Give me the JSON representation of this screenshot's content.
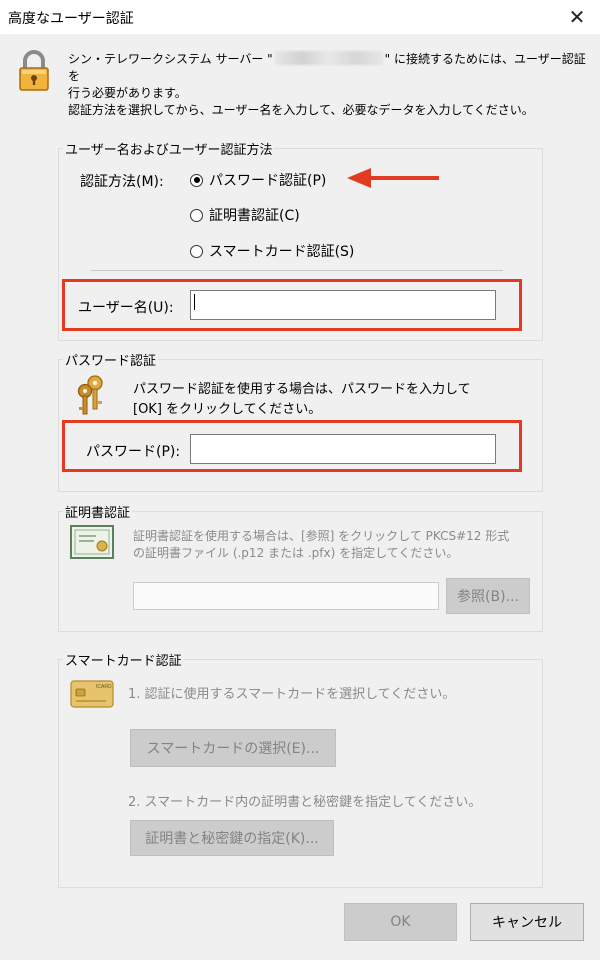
{
  "window": {
    "title": "高度なユーザー認証"
  },
  "intro": {
    "line1_before": "シン・テレワークシステム サーバー \"",
    "line1_after": "\" に接続するためには、ユーザー認証を",
    "line2": "行う必要があります。",
    "line3": "認証方法を選択してから、ユーザー名を入力して、必要なデータを入力してください。"
  },
  "user_group": {
    "title": "ユーザー名およびユーザー認証方法",
    "method_label": "認証方法(M):",
    "options": [
      {
        "label": "パスワード認証(P)",
        "selected": true
      },
      {
        "label": "証明書認証(C)",
        "selected": false
      },
      {
        "label": "スマートカード認証(S)",
        "selected": false
      }
    ],
    "username_label": "ユーザー名(U):",
    "username_value": ""
  },
  "password_group": {
    "title": "パスワード認証",
    "desc_line1": "パスワード認証を使用する場合は、パスワードを入力して",
    "desc_line2": "[OK] をクリックしてください。",
    "password_label": "パスワード(P):",
    "password_value": ""
  },
  "cert_group": {
    "title": "証明書認証",
    "desc_line1": "証明書認証を使用する場合は、[参照] をクリックして PKCS#12 形式",
    "desc_line2": "の証明書ファイル (.p12 または .pfx) を指定してください。",
    "browse_label": "参照(B)..."
  },
  "smartcard_group": {
    "title": "スマートカード認証",
    "step1": "1. 認証に使用するスマートカードを選択してください。",
    "select_button": "スマートカードの選択(E)...",
    "step2": "2. スマートカード内の証明書と秘密鍵を指定してください。",
    "key_button": "証明書と秘密鍵の指定(K)...",
    "card_text": "ICARD"
  },
  "footer": {
    "ok": "OK",
    "cancel": "キャンセル"
  },
  "colors": {
    "highlight": "#e23b22",
    "arrow": "#e23b22"
  }
}
